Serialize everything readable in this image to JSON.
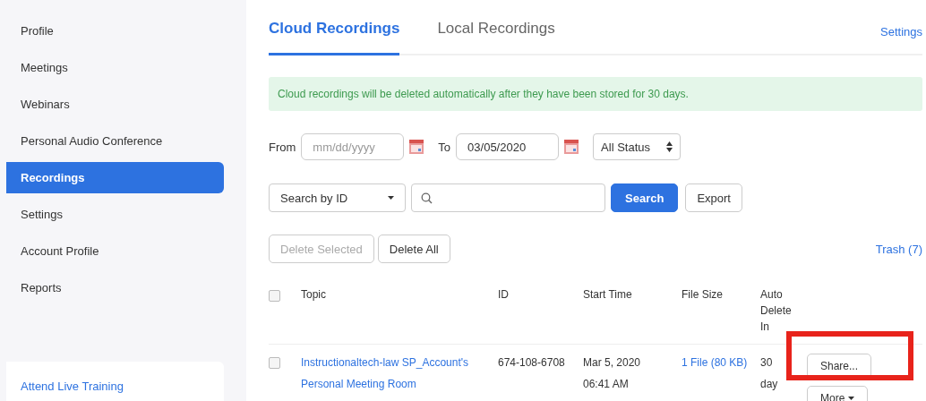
{
  "sidebar": {
    "items": [
      {
        "label": "Profile",
        "selected": false
      },
      {
        "label": "Meetings",
        "selected": false
      },
      {
        "label": "Webinars",
        "selected": false
      },
      {
        "label": "Personal Audio Conference",
        "selected": false
      },
      {
        "label": "Recordings",
        "selected": true
      },
      {
        "label": "Settings",
        "selected": false
      },
      {
        "label": "Account Profile",
        "selected": false
      },
      {
        "label": "Reports",
        "selected": false
      }
    ],
    "footer_link": "Attend Live Training"
  },
  "tabs": [
    {
      "label": "Cloud Recordings",
      "selected": true
    },
    {
      "label": "Local Recordings",
      "selected": false
    }
  ],
  "settings_link": "Settings",
  "notice": "Cloud recordings will be deleted automatically after they have been stored for 30 days.",
  "filters": {
    "from_label": "From",
    "from": {
      "placeholder": "mm/dd/yyyy"
    },
    "to_label": "To",
    "to": {
      "value": "03/05/2020"
    },
    "status": "All Status"
  },
  "search": {
    "by": "Search by ID",
    "search_button": "Search",
    "export_button": "Export"
  },
  "actions": [
    {
      "label": "Delete Selected",
      "disabled": true
    },
    {
      "label": "Delete All",
      "disabled": false
    }
  ],
  "trash_link": "Trash (7)",
  "table": {
    "columns": [
      "Topic",
      "ID",
      "Start Time",
      "File Size",
      "Auto Delete In"
    ],
    "header_checked": false,
    "rows": [
      {
        "checked": false,
        "topic": "Instructionaltech-law SP_Account's Personal Meeting Room",
        "id": "674-108-6708",
        "start_time": "Mar 5, 2020 06:41 AM",
        "file_size": "1 File (80 KB)",
        "auto_delete": "30 day",
        "share_button": "Share...",
        "more_button": "More"
      }
    ]
  },
  "highlight": {
    "shown": true
  }
}
